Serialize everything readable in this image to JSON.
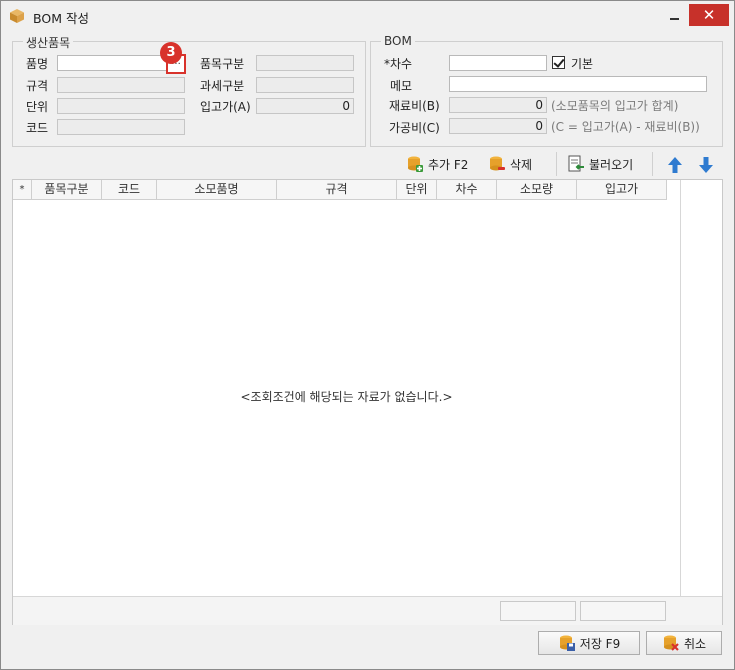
{
  "window": {
    "title": "BOM 작성",
    "close_label": "✕"
  },
  "product_group": {
    "title": "생산품목",
    "name_label": "품명",
    "spec_label": "규격",
    "unit_label": "단위",
    "code_label": "코드",
    "item_type_label": "품목구분",
    "tax_type_label": "과세구분",
    "cost_label": "입고가(A)",
    "cost_value": "0",
    "lookup_label": "...",
    "step_badge": "3"
  },
  "bom_group": {
    "title": "BOM",
    "version_label": "*차수",
    "default_label": "기본",
    "default_checked": true,
    "memo_label": "메모",
    "material_label": "재료비(B)",
    "material_value": "0",
    "material_hint": "(소모품목의 입고가 합계)",
    "process_label": "가공비(C)",
    "process_value": "0",
    "process_hint": "(C = 입고가(A) - 재료비(B))"
  },
  "toolbar": {
    "add_label": "추가 F2",
    "delete_label": "삭제",
    "load_label": "불러오기"
  },
  "grid": {
    "columns": [
      "*",
      "품목구분",
      "코드",
      "소모품명",
      "규격",
      "단위",
      "차수",
      "소모량",
      "입고가"
    ],
    "empty_message": "<조회조건에 해당되는 자료가 없습니다.>"
  },
  "footer": {
    "save_label": "저장 F9",
    "cancel_label": "취소"
  }
}
